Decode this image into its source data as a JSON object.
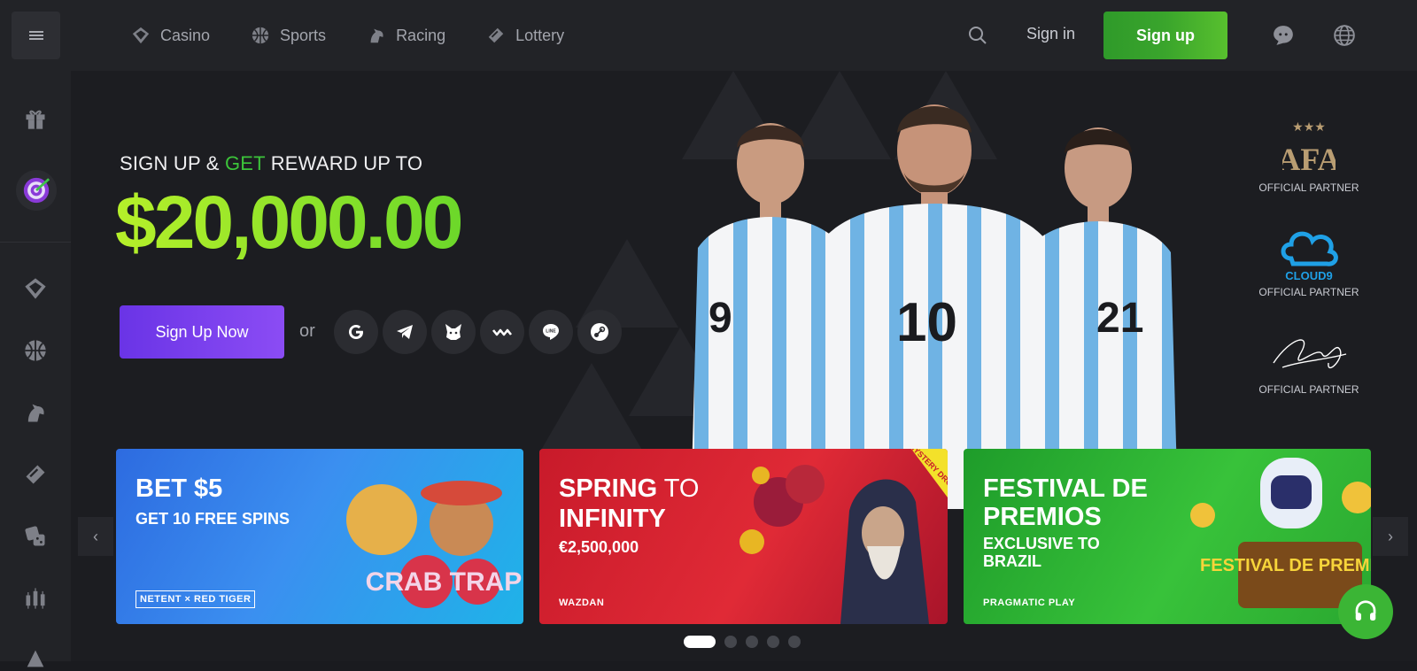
{
  "header": {
    "nav": [
      {
        "label": "Casino",
        "icon": "casino-icon"
      },
      {
        "label": "Sports",
        "icon": "sports-icon"
      },
      {
        "label": "Racing",
        "icon": "racing-icon"
      },
      {
        "label": "Lottery",
        "icon": "lottery-icon"
      }
    ],
    "signin_label": "Sign in",
    "signup_label": "Sign up"
  },
  "sidebar": {
    "icons": [
      "gift-icon",
      "target-icon",
      "casino-icon",
      "sports-icon",
      "racing-icon",
      "lottery-icon",
      "dice-icon",
      "chart-icon"
    ]
  },
  "hero": {
    "subtitle_pre": "SIGN UP & ",
    "subtitle_get": "GET",
    "subtitle_post": " REWARD UP TO",
    "amount": "$20,000.00",
    "cta_label": "Sign Up Now",
    "or_label": "or",
    "social_icons": [
      "google-icon",
      "telegram-icon",
      "metamask-icon",
      "walletconnect-icon",
      "line-icon",
      "steam-icon"
    ],
    "jersey_numbers": [
      "9",
      "10",
      "21"
    ]
  },
  "partners": [
    {
      "logo": "AFA",
      "label": "OFFICIAL PARTNER"
    },
    {
      "logo": "CLOUD9",
      "label": "OFFICIAL PARTNER"
    },
    {
      "logo": "signature",
      "label": "OFFICIAL PARTNER"
    }
  ],
  "promos": [
    {
      "title": "BET $5",
      "subtitle": "GET 10 FREE SPINS",
      "brand": "NETENT × RED TIGER",
      "art": "CRAB TRAP"
    },
    {
      "title_a": "SPRING",
      "title_b": " TO",
      "title_c": "INFINITY",
      "subtitle": "€2,500,000",
      "brand": "WAZDAN",
      "ribbon": "MYSTERY DROP"
    },
    {
      "title": "FESTIVAL DE PREMIOS",
      "subtitle": "EXCLUSIVE TO BRAZIL",
      "brand": "PRAGMATIC PLAY",
      "art": "FESTIVAL DE PREMIOS"
    }
  ],
  "carousel": {
    "page": 1,
    "total": 5
  },
  "colors": {
    "accent_green": "#3aa52c",
    "accent_purple": "#7b40f0",
    "amount_gradient_start": "#b6f02a",
    "amount_gradient_end": "#6cd82a"
  }
}
